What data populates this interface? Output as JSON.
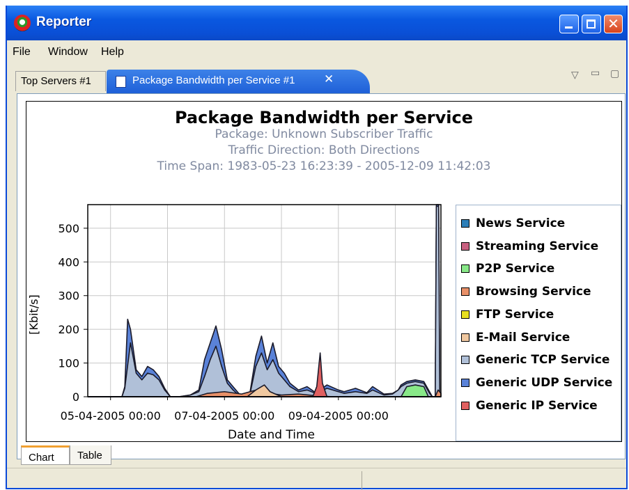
{
  "window": {
    "title": "Reporter"
  },
  "menu": [
    "File",
    "Window",
    "Help"
  ],
  "tabs": [
    {
      "label": "Top Servers #1"
    },
    {
      "label": "Package Bandwidth per Service #1"
    }
  ],
  "icons": {
    "app": "app-logo-icon",
    "doc": "document-icon",
    "close": "close-icon",
    "minimize": "minimize-icon",
    "maximize": "maximize-icon",
    "view_menu": "view-menu-icon"
  },
  "chart_data": {
    "type": "area",
    "title": "Package Bandwidth per Service",
    "subtitles": [
      "Package: Unknown Subscriber Traffic",
      "Traffic Direction: Both Directions",
      "Time Span: 1983-05-23 16:23:39 - 2005-12-09 11:42:03"
    ],
    "xlabel": "Date and Time",
    "ylabel": "[Kbit/s]",
    "x_ticks": [
      "05-04-2005 00:00",
      "07-04-2005 00:00",
      "09-04-2005 00:00"
    ],
    "y_ticks": [
      0,
      100,
      200,
      300,
      400,
      500
    ],
    "ylim": [
      0,
      570
    ],
    "x_range_days": [
      4.6,
      10.8
    ],
    "grid": true,
    "legend_position": "right",
    "series": [
      {
        "name": "News Service",
        "color": "#2d7fb8",
        "points": []
      },
      {
        "name": "Streaming Service",
        "color": "#c86080",
        "points": []
      },
      {
        "name": "P2P Service",
        "color": "#88e888",
        "points": [
          [
            10.1,
            0
          ],
          [
            10.2,
            30
          ],
          [
            10.35,
            35
          ],
          [
            10.5,
            30
          ],
          [
            10.58,
            0
          ]
        ]
      },
      {
        "name": "Browsing Service",
        "color": "#e89068",
        "points": [
          [
            6.5,
            0
          ],
          [
            6.7,
            10
          ],
          [
            7.0,
            15
          ],
          [
            7.3,
            8
          ],
          [
            7.6,
            22
          ],
          [
            7.8,
            10
          ],
          [
            8.0,
            5
          ],
          [
            8.3,
            8
          ],
          [
            8.6,
            3
          ],
          [
            8.9,
            0
          ],
          [
            10.7,
            0
          ],
          [
            10.75,
            20
          ],
          [
            10.8,
            10
          ]
        ]
      },
      {
        "name": "FTP Service",
        "color": "#e8e020",
        "points": []
      },
      {
        "name": "E-Mail Service",
        "color": "#f0c8a0",
        "points": [
          [
            7.4,
            0
          ],
          [
            7.55,
            20
          ],
          [
            7.7,
            35
          ],
          [
            7.8,
            15
          ],
          [
            8.0,
            0
          ]
        ]
      },
      {
        "name": "Generic TCP Service",
        "color": "#b0c0d8",
        "points": [
          [
            5.2,
            0
          ],
          [
            5.25,
            25
          ],
          [
            5.35,
            160
          ],
          [
            5.45,
            70
          ],
          [
            5.55,
            50
          ],
          [
            5.65,
            70
          ],
          [
            5.75,
            65
          ],
          [
            5.85,
            50
          ],
          [
            5.95,
            20
          ],
          [
            6.05,
            0
          ],
          [
            6.2,
            0
          ],
          [
            6.4,
            5
          ],
          [
            6.55,
            15
          ],
          [
            6.65,
            60
          ],
          [
            6.75,
            110
          ],
          [
            6.85,
            150
          ],
          [
            6.95,
            90
          ],
          [
            7.05,
            40
          ],
          [
            7.15,
            20
          ],
          [
            7.25,
            5
          ],
          [
            7.35,
            0
          ],
          [
            7.45,
            10
          ],
          [
            7.55,
            90
          ],
          [
            7.65,
            130
          ],
          [
            7.75,
            80
          ],
          [
            7.85,
            110
          ],
          [
            7.95,
            70
          ],
          [
            8.05,
            50
          ],
          [
            8.15,
            30
          ],
          [
            8.3,
            15
          ],
          [
            8.45,
            20
          ],
          [
            8.6,
            10
          ],
          [
            8.8,
            25
          ],
          [
            9.0,
            15
          ],
          [
            9.1,
            10
          ],
          [
            9.3,
            15
          ],
          [
            9.5,
            10
          ],
          [
            9.6,
            20
          ],
          [
            9.8,
            5
          ],
          [
            9.95,
            8
          ],
          [
            10.05,
            20
          ],
          [
            10.1,
            30
          ],
          [
            10.2,
            40
          ],
          [
            10.35,
            45
          ],
          [
            10.5,
            40
          ],
          [
            10.6,
            10
          ],
          [
            10.65,
            0
          ],
          [
            10.7,
            0
          ],
          [
            10.72,
            565
          ],
          [
            10.76,
            565
          ],
          [
            10.78,
            0
          ]
        ]
      },
      {
        "name": "Generic UDP Service",
        "color": "#5a82d8",
        "points": [
          [
            5.2,
            0
          ],
          [
            5.25,
            30
          ],
          [
            5.3,
            230
          ],
          [
            5.35,
            200
          ],
          [
            5.45,
            80
          ],
          [
            5.55,
            60
          ],
          [
            5.65,
            90
          ],
          [
            5.75,
            80
          ],
          [
            5.85,
            60
          ],
          [
            5.95,
            25
          ],
          [
            6.05,
            0
          ],
          [
            6.2,
            0
          ],
          [
            6.4,
            5
          ],
          [
            6.55,
            20
          ],
          [
            6.65,
            110
          ],
          [
            6.75,
            160
          ],
          [
            6.85,
            210
          ],
          [
            6.95,
            140
          ],
          [
            7.05,
            50
          ],
          [
            7.15,
            30
          ],
          [
            7.25,
            10
          ],
          [
            7.35,
            0
          ],
          [
            7.45,
            15
          ],
          [
            7.55,
            120
          ],
          [
            7.65,
            180
          ],
          [
            7.75,
            100
          ],
          [
            7.85,
            160
          ],
          [
            7.95,
            90
          ],
          [
            8.05,
            70
          ],
          [
            8.15,
            40
          ],
          [
            8.3,
            20
          ],
          [
            8.45,
            30
          ],
          [
            8.6,
            12
          ],
          [
            8.8,
            35
          ],
          [
            9.0,
            20
          ],
          [
            9.1,
            15
          ],
          [
            9.3,
            25
          ],
          [
            9.5,
            12
          ],
          [
            9.6,
            30
          ],
          [
            9.8,
            8
          ],
          [
            9.95,
            10
          ],
          [
            10.05,
            20
          ],
          [
            10.1,
            35
          ],
          [
            10.2,
            45
          ],
          [
            10.35,
            50
          ],
          [
            10.5,
            45
          ],
          [
            10.6,
            15
          ],
          [
            10.65,
            0
          ],
          [
            10.7,
            0
          ],
          [
            10.72,
            570
          ],
          [
            10.76,
            570
          ],
          [
            10.78,
            0
          ]
        ]
      },
      {
        "name": "Generic IP Service",
        "color": "#e06060",
        "points": [
          [
            8.55,
            0
          ],
          [
            8.62,
            30
          ],
          [
            8.68,
            130
          ],
          [
            8.72,
            40
          ],
          [
            8.8,
            0
          ]
        ]
      }
    ]
  },
  "bottom_tabs": [
    {
      "label": "Chart"
    },
    {
      "label": "Table"
    }
  ]
}
